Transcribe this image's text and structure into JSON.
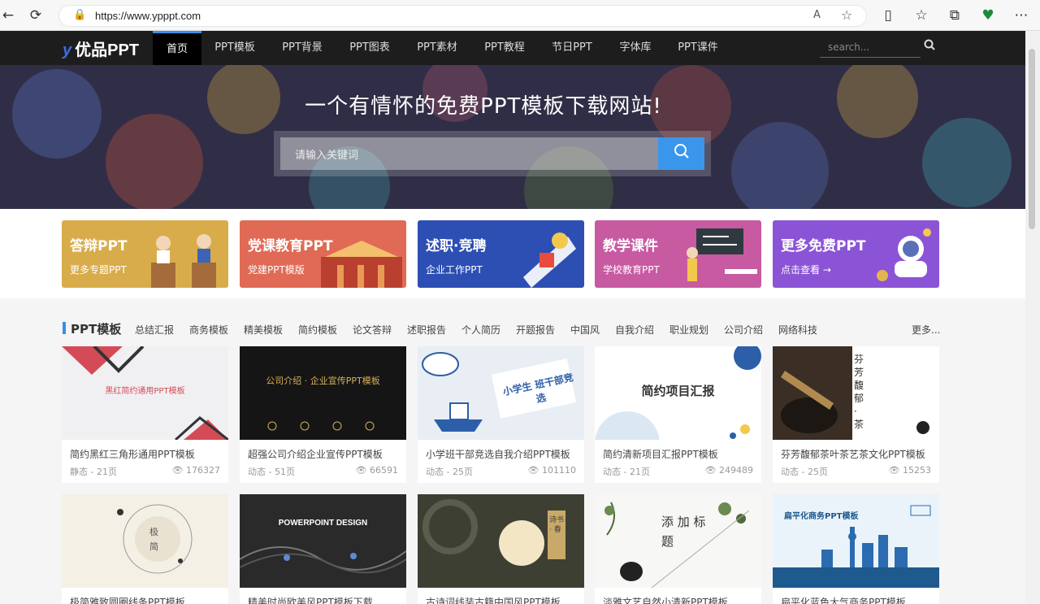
{
  "browser": {
    "url": "https://www.ypppt.com",
    "icons": [
      "back-icon",
      "refresh-icon",
      "lock-icon",
      "read-aloud-icon",
      "favorite-icon",
      "split-icon",
      "favorites-icon",
      "collections-icon",
      "extension-icon",
      "more-icon"
    ]
  },
  "nav": {
    "logo_mark": "y",
    "logo_text": "优品PPT",
    "items": [
      "首页",
      "PPT模板",
      "PPT背景",
      "PPT图表",
      "PPT素材",
      "PPT教程",
      "节日PPT",
      "字体库",
      "PPT课件"
    ],
    "search_placeholder": "search..."
  },
  "hero": {
    "title": "一个有情怀的免费PPT模板下载网站!",
    "search_placeholder": "请输入关键词"
  },
  "banners": [
    {
      "title": "答辩PPT",
      "sub": "更多专题PPT",
      "color": "#d9ac4b"
    },
    {
      "title": "党课教育PPT",
      "sub": "党建PPT模版",
      "color": "#e06a55"
    },
    {
      "title": "述职·竞聘",
      "sub": "企业工作PPT",
      "color": "#2d4fb3"
    },
    {
      "title": "教学课件",
      "sub": "学校教育PPT",
      "color": "#c85aa2"
    },
    {
      "title": "更多免费PPT",
      "sub": "点击查看 →",
      "color": "#8b54d6"
    }
  ],
  "section": {
    "title": "PPT模板",
    "tags": [
      "总结汇报",
      "商务模板",
      "精美模板",
      "简约模板",
      "论文答辩",
      "述职报告",
      "个人简历",
      "开题报告",
      "中国风",
      "自我介绍",
      "职业规划",
      "公司介绍",
      "网络科技"
    ],
    "more": "更多..."
  },
  "cards": [
    {
      "title": "简约黑红三角形通用PPT模板",
      "meta": "静态 - 21页",
      "views": "176327",
      "thumb_text": "黑红简约通用PPT模板"
    },
    {
      "title": "超强公司介绍企业宣传PPT模板",
      "meta": "动态 - 51页",
      "views": "66591",
      "thumb_text": "公司介绍 · 企业宣传PPT模板"
    },
    {
      "title": "小学班干部竞选自我介绍PPT模板",
      "meta": "动态 - 25页",
      "views": "101110",
      "thumb_text": "小学生 班干部竞选"
    },
    {
      "title": "简约清新项目汇报PPT模板",
      "meta": "动态 - 21页",
      "views": "249489",
      "thumb_text": "简约项目汇报"
    },
    {
      "title": "芬芳馥郁茶叶茶艺茶文化PPT模板",
      "meta": "动态 - 25页",
      "views": "15253",
      "thumb_text": "芬芳馥郁 · 茶"
    },
    {
      "title": "极简雅致圆圈线条PPT模板",
      "meta": "",
      "views": "",
      "thumb_text": "极 简"
    },
    {
      "title": "精美时尚欧美风PPT模板下载",
      "meta": "",
      "views": "",
      "thumb_text": "POWERPOINT DESIGN"
    },
    {
      "title": "古诗词线装古籍中国风PPT模板",
      "meta": "",
      "views": "",
      "thumb_text": "诗书 · 春"
    },
    {
      "title": "淡雅文艺自然小清新PPT模板",
      "meta": "",
      "views": "",
      "thumb_text": "添 加 标 题"
    },
    {
      "title": "扁平化蓝色大气商务PPT模板",
      "meta": "",
      "views": "",
      "thumb_text": "扁平化商务PPT模板"
    }
  ]
}
